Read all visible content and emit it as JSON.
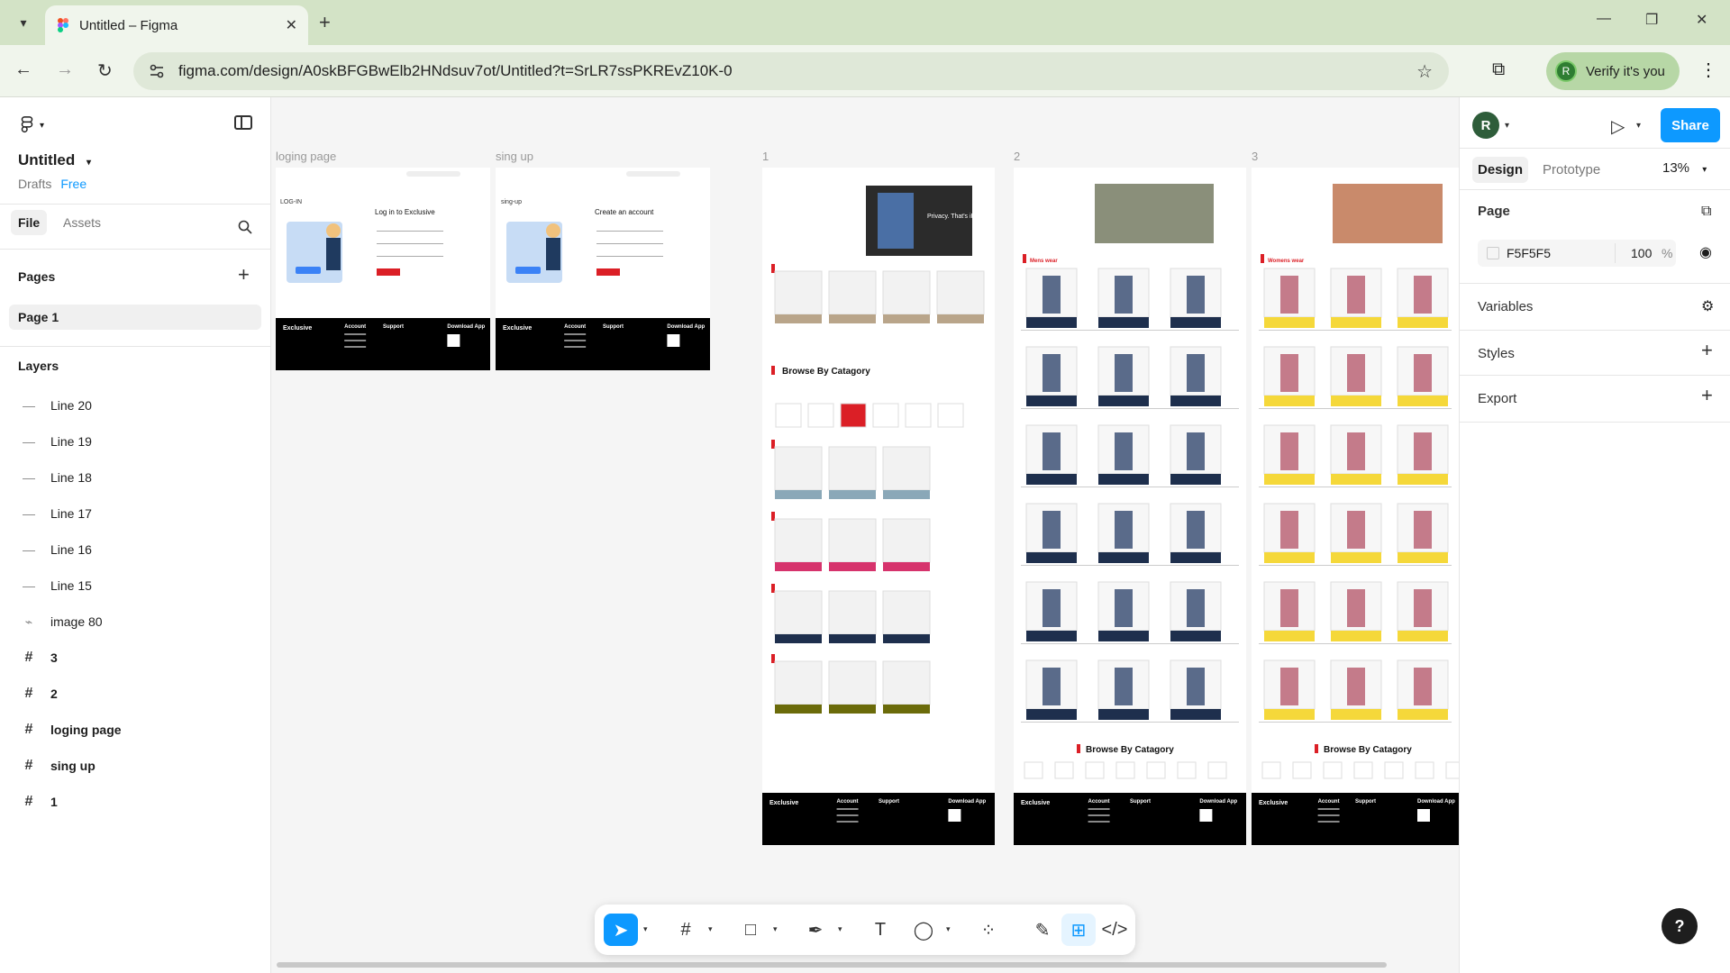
{
  "browser": {
    "tab_title": "Untitled – Figma",
    "url": "figma.com/design/A0skBFGBwElb2HNdsuv7ot/Untitled?t=SrLR7ssPKREvZ10K-0",
    "verify_label": "Verify it's you",
    "verify_avatar": "R"
  },
  "left": {
    "file_title": "Untitled",
    "location": "Drafts",
    "plan": "Free",
    "tabs": [
      "File",
      "Assets"
    ],
    "pages_title": "Pages",
    "page_item": "Page 1",
    "layers_title": "Layers",
    "layers": [
      {
        "name": "Line 20",
        "icon": "line-icon"
      },
      {
        "name": "Line 19",
        "icon": "line-icon"
      },
      {
        "name": "Line 18",
        "icon": "line-icon"
      },
      {
        "name": "Line 17",
        "icon": "line-icon"
      },
      {
        "name": "Line 16",
        "icon": "line-icon"
      },
      {
        "name": "Line 15",
        "icon": "line-icon"
      },
      {
        "name": "image 80",
        "icon": "image-icon"
      },
      {
        "name": "3",
        "icon": "frame-icon"
      },
      {
        "name": "2",
        "icon": "frame-icon"
      },
      {
        "name": "loging page",
        "icon": "frame-icon"
      },
      {
        "name": "sing up",
        "icon": "frame-icon"
      },
      {
        "name": "1",
        "icon": "frame-icon"
      }
    ]
  },
  "canvas": {
    "frame_labels": [
      "loging page",
      "sing up",
      "1",
      "2",
      "3"
    ],
    "login": {
      "heading": "Log in to Exclusive",
      "side": "LOG-IN"
    },
    "signup": {
      "heading": "Create an account",
      "side": "sing-up"
    },
    "frame1": {
      "section1": "Browse By Catagory",
      "hero": "Privacy. That's iPhone."
    },
    "frame2": {
      "section": "Browse By Catagory",
      "cat": "Mens wear"
    },
    "frame3": {
      "section": "Browse By Catagory",
      "cat": "Womens wear"
    },
    "footer": {
      "brand": "Exclusive",
      "account": "Account",
      "support": "Support",
      "download": "Download App"
    }
  },
  "right": {
    "avatar": "R",
    "share_label": "Share",
    "tabs": [
      "Design",
      "Prototype"
    ],
    "zoom": "13%",
    "page_title": "Page",
    "page_color": "F5F5F5",
    "page_opacity": "100",
    "opacity_unit": "%",
    "sections": [
      "Variables",
      "Styles",
      "Export"
    ]
  },
  "colors": {
    "accent": "#0d99ff",
    "tabbar": "#d3e3c6",
    "product_red": "#db1f26"
  }
}
